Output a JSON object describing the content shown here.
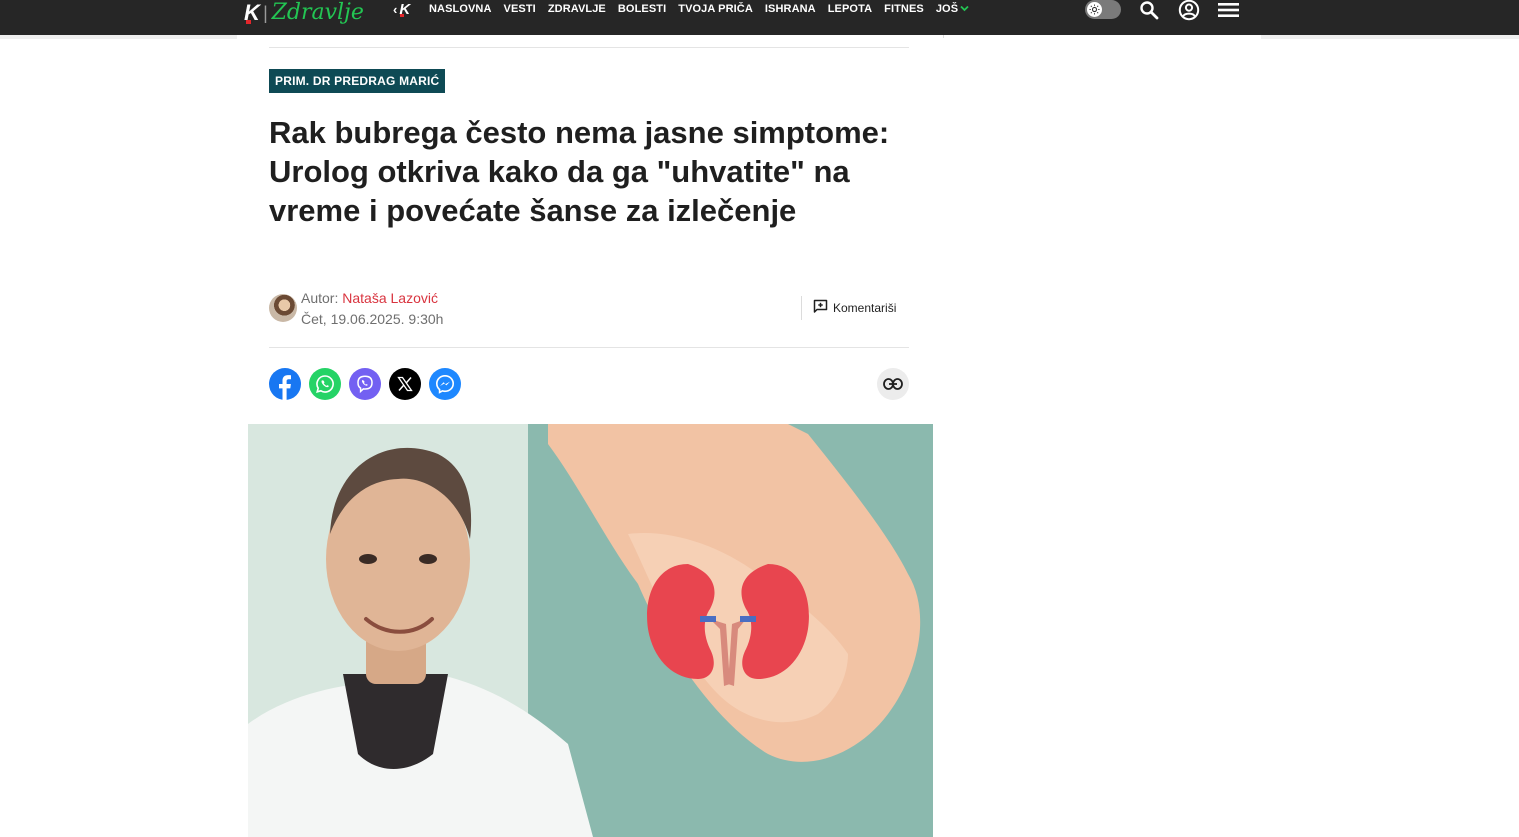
{
  "header": {
    "logo_brand": "K",
    "logo_section": "Zdravlje",
    "back_brand": "K",
    "nav_items": [
      "NASLOVNA",
      "VESTI",
      "ZDRAVLJE",
      "BOLESTI",
      "TVOJA PRIČA",
      "ISHRANA",
      "LEPOTA",
      "FITNES"
    ],
    "more_label": "JOŠ",
    "accent_color": "#23c553",
    "background_color": "#262626",
    "icons": [
      "theme-toggle-icon",
      "search-icon",
      "account-icon",
      "menu-icon"
    ]
  },
  "article": {
    "tag": "PRIM. DR PREDRAG MARIĆ",
    "tag_color": "#0e4a55",
    "title": "Rak bubrega često nema jasne simptome: Urolog otkriva kako da ga \"uhvatite\" na vreme i povećate šanse za izlečenje",
    "author_prefix": "Autor:",
    "author_name": "Nataša Lazović",
    "author_color": "#d9343f",
    "date": "Čet, 19.06.2025. 9:30h",
    "comment_label": "Komentariši"
  },
  "share": {
    "networks": [
      "facebook",
      "whatsapp",
      "viber",
      "x",
      "messenger"
    ],
    "colors": {
      "facebook": "#1877f2",
      "whatsapp": "#25d366",
      "viber": "#7360f2",
      "x": "#000000",
      "messenger": "#1e88ff"
    },
    "copy_icon": "link-icon"
  },
  "hero_image": {
    "subject": "doctor-with-kidney-model-in-hands"
  }
}
